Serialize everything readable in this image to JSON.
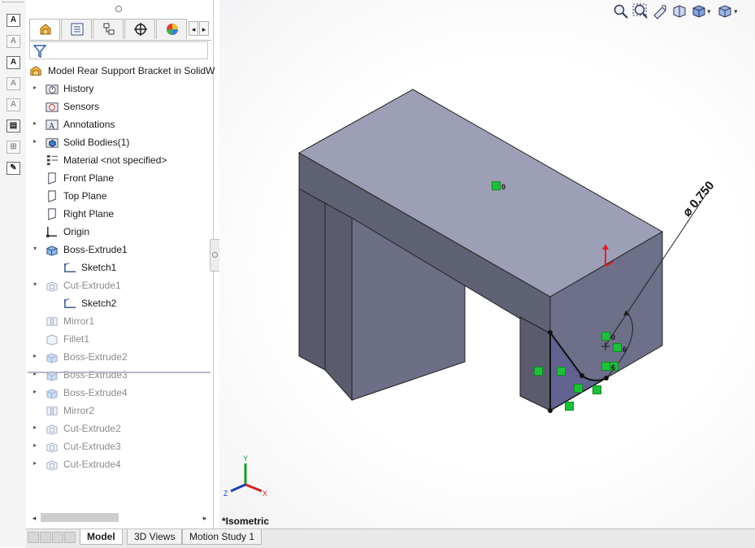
{
  "feature_manager": {
    "root": "Model Rear Support Bracket in SolidW",
    "items": [
      {
        "label": "History",
        "icon": "history-folder-icon",
        "expandable": true,
        "suppressed": false
      },
      {
        "label": "Sensors",
        "icon": "sensors-folder-icon",
        "expandable": false,
        "suppressed": false
      },
      {
        "label": "Annotations",
        "icon": "annotations-folder-icon",
        "expandable": true,
        "suppressed": false
      },
      {
        "label": "Solid Bodies(1)",
        "icon": "solid-bodies-folder-icon",
        "expandable": true,
        "suppressed": false
      },
      {
        "label": "Material <not specified>",
        "icon": "material-icon",
        "expandable": false,
        "suppressed": false
      },
      {
        "label": "Front Plane",
        "icon": "plane-icon",
        "expandable": false,
        "suppressed": false
      },
      {
        "label": "Top Plane",
        "icon": "plane-icon",
        "expandable": false,
        "suppressed": false
      },
      {
        "label": "Right Plane",
        "icon": "plane-icon",
        "expandable": false,
        "suppressed": false
      },
      {
        "label": "Origin",
        "icon": "origin-icon",
        "expandable": false,
        "suppressed": false
      },
      {
        "label": "Boss-Extrude1",
        "icon": "boss-extrude-icon",
        "expandable": true,
        "expanded": true,
        "suppressed": false
      },
      {
        "label": "Sketch1",
        "icon": "sketch-icon",
        "child": true,
        "suppressed": false
      },
      {
        "label": "Cut-Extrude1",
        "icon": "cut-extrude-icon",
        "expandable": true,
        "expanded": true,
        "suppressed": true
      },
      {
        "label": "Sketch2",
        "icon": "sketch-icon",
        "child": true,
        "suppressed": false
      },
      {
        "label": "Mirror1",
        "icon": "mirror-icon",
        "expandable": false,
        "suppressed": true
      },
      {
        "label": "Fillet1",
        "icon": "fillet-icon",
        "expandable": false,
        "suppressed": true
      },
      {
        "label": "Boss-Extrude2",
        "icon": "boss-extrude-icon",
        "expandable": true,
        "suppressed": true
      },
      {
        "label": "Boss-Extrude3",
        "icon": "boss-extrude-icon",
        "expandable": true,
        "suppressed": true
      },
      {
        "label": "Boss-Extrude4",
        "icon": "boss-extrude-icon",
        "expandable": true,
        "suppressed": true
      },
      {
        "label": "Mirror2",
        "icon": "mirror-icon",
        "expandable": false,
        "suppressed": true
      },
      {
        "label": "Cut-Extrude2",
        "icon": "cut-extrude-icon",
        "expandable": true,
        "suppressed": true
      },
      {
        "label": "Cut-Extrude3",
        "icon": "cut-extrude-icon",
        "expandable": true,
        "suppressed": true
      },
      {
        "label": "Cut-Extrude4",
        "icon": "cut-extrude-icon",
        "expandable": true,
        "suppressed": true
      }
    ]
  },
  "bottom_tabs": [
    {
      "label": "Model",
      "active": true
    },
    {
      "label": "3D Views",
      "active": false
    },
    {
      "label": "Motion Study 1",
      "active": false
    }
  ],
  "graphics": {
    "view_label": "*Isometric",
    "dimension": "⌀ 0.750",
    "relation_labels": [
      "0",
      "0",
      "6",
      "6"
    ],
    "triad_labels": {
      "x": "X",
      "y": "Y",
      "z": "Z"
    }
  },
  "colors": {
    "model_top": "#9a9db3",
    "model_front": "#6d7088",
    "model_side": "#5a5c6e",
    "relation_green": "#1fbf3c",
    "sketch_line": "#111111"
  }
}
